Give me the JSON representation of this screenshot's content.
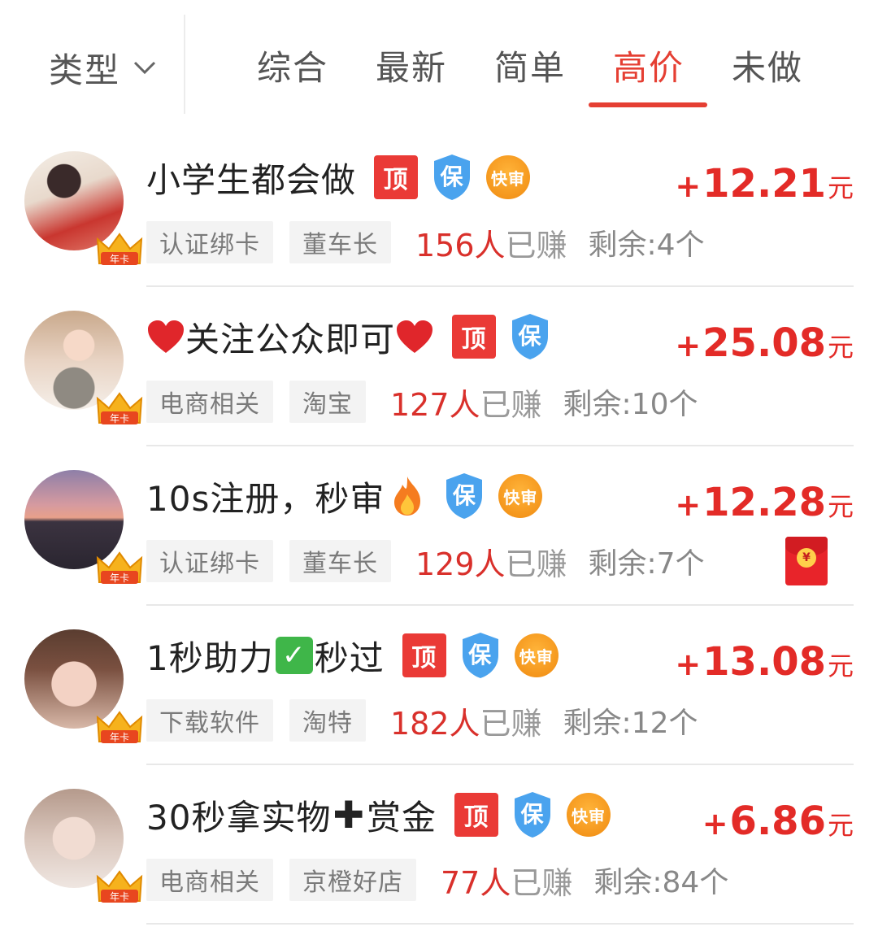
{
  "filter": {
    "type_label": "类型"
  },
  "tabs": [
    {
      "label": "综合",
      "active": false
    },
    {
      "label": "最新",
      "active": false
    },
    {
      "label": "简单",
      "active": false
    },
    {
      "label": "高价",
      "active": true
    },
    {
      "label": "未做",
      "active": false
    }
  ],
  "colors": {
    "accent": "#e53f33",
    "price": "#e32b27",
    "badge_top": "#ea3a36",
    "badge_shield": "#4aa3ee",
    "badge_fast": "#f5961e"
  },
  "badges": {
    "top": "顶",
    "guarantee": "保",
    "fast": "快审",
    "crown": "年卡"
  },
  "tasks": [
    {
      "title": "小学生都会做",
      "title_suffix": "",
      "badges": [
        "top",
        "guarantee",
        "fast"
      ],
      "tags": [
        "认证绑卡",
        "董车长"
      ],
      "earned_count": "156人",
      "earned_unit": "已赚",
      "remaining": "剩余:4个",
      "price_sign": "+",
      "price": "12.21",
      "price_unit": "元"
    },
    {
      "title": "关注公众即可",
      "title_prefix_icon": "heart-icon",
      "title_suffix_icon": "heart-icon",
      "badges": [
        "top",
        "guarantee"
      ],
      "tags": [
        "电商相关",
        "淘宝"
      ],
      "earned_count": "127人",
      "earned_unit": "已赚",
      "remaining": "剩余:10个",
      "price_sign": "+",
      "price": "25.08",
      "price_unit": "元"
    },
    {
      "title": "10s注册，秒审",
      "title_suffix_icon": "fire-icon",
      "badges": [
        "guarantee",
        "fast"
      ],
      "tags": [
        "认证绑卡",
        "董车长"
      ],
      "earned_count": "129人",
      "earned_unit": "已赚",
      "remaining": "剩余:7个",
      "price_sign": "+",
      "price": "12.28",
      "price_unit": "元",
      "extra_icon": "red-packet-icon"
    },
    {
      "title_part1": "1秒助力",
      "title_part2": "秒过",
      "title_mid_icon": "check-icon",
      "badges": [
        "top",
        "guarantee",
        "fast"
      ],
      "tags": [
        "下载软件",
        "淘特"
      ],
      "earned_count": "182人",
      "earned_unit": "已赚",
      "remaining": "剩余:12个",
      "price_sign": "+",
      "price": "13.08",
      "price_unit": "元"
    },
    {
      "title_part1": "30秒拿实物",
      "title_part2": "赏金",
      "title_mid_icon": "plus-icon",
      "badges": [
        "top",
        "guarantee",
        "fast"
      ],
      "tags": [
        "电商相关",
        "京橙好店"
      ],
      "earned_count": "77人",
      "earned_unit": "已赚",
      "remaining": "剩余:84个",
      "price_sign": "+",
      "price": "6.86",
      "price_unit": "元"
    }
  ]
}
